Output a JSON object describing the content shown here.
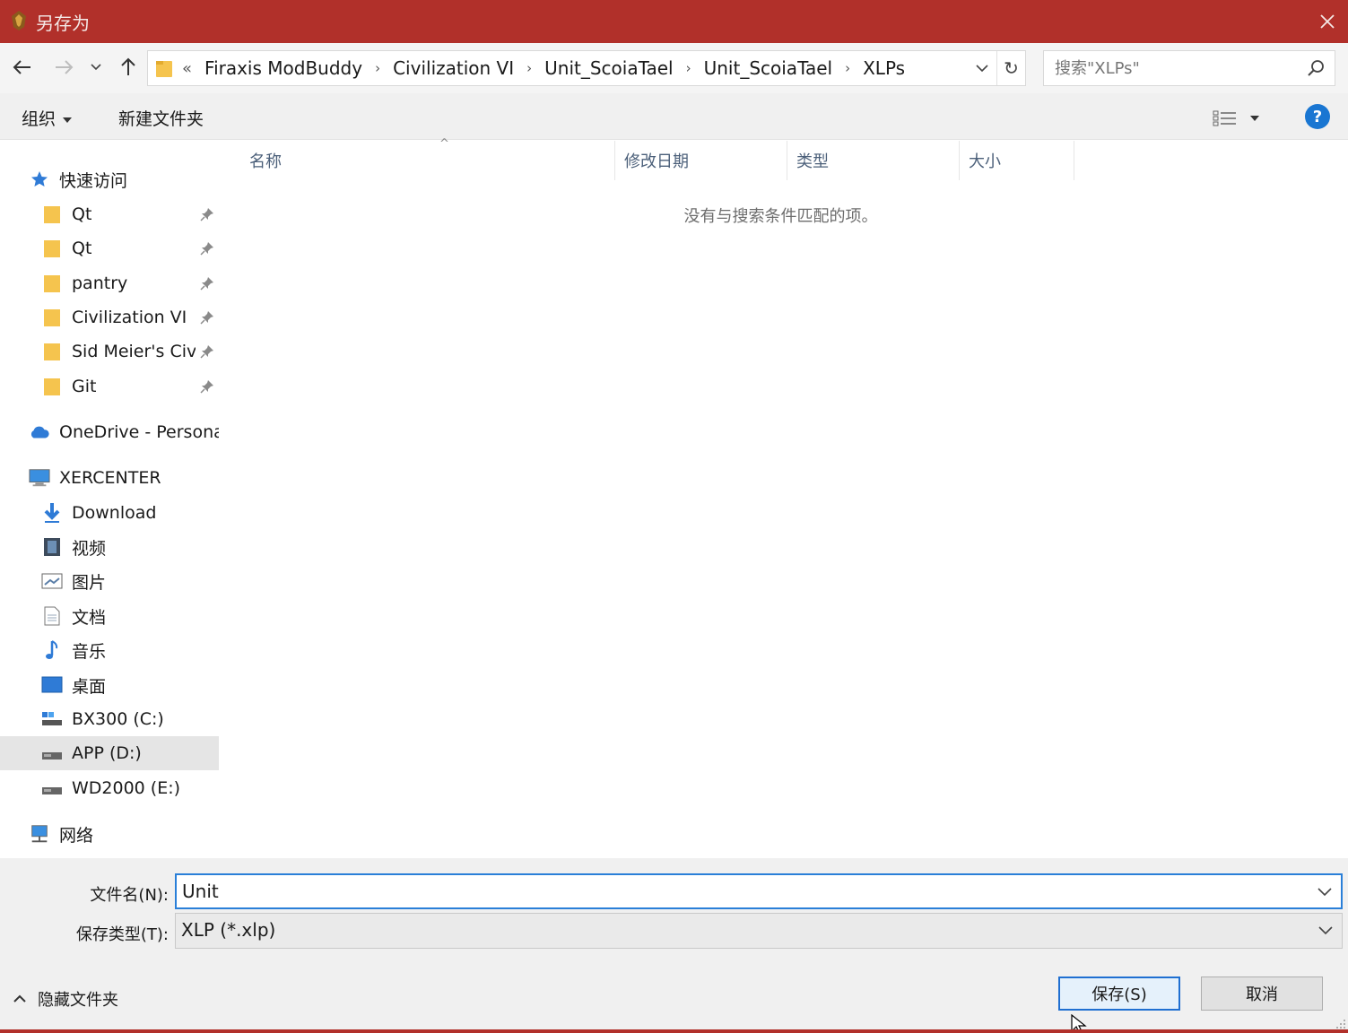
{
  "window": {
    "title": "另存为",
    "accent_color": "#b1302a"
  },
  "nav": {
    "breadcrumb_overflow": "«",
    "breadcrumbs": [
      "Firaxis ModBuddy",
      "Civilization VI",
      "Unit_ScoiaTael",
      "Unit_ScoiaTael",
      "XLPs"
    ],
    "search_placeholder": "搜索\"XLPs\""
  },
  "toolbar": {
    "organize": "组织",
    "new_folder": "新建文件夹"
  },
  "sidebar": {
    "quick_access": "快速访问",
    "quick_items": [
      "Qt",
      "Qt",
      "pantry",
      "Civilization VI",
      "Sid Meier's Civ",
      "Git"
    ],
    "onedrive": "OneDrive - Personal",
    "computer": "XERCENTER",
    "computer_items": [
      "Download",
      "视频",
      "图片",
      "文档",
      "音乐",
      "桌面",
      "BX300 (C:)",
      "APP (D:)",
      "WD2000 (E:)"
    ],
    "selected": "APP (D:)",
    "network": "网络"
  },
  "content": {
    "columns": [
      "名称",
      "修改日期",
      "类型",
      "大小"
    ],
    "empty_message": "没有与搜索条件匹配的项。"
  },
  "form": {
    "filename_label": "文件名(N):",
    "filename_value": "Unit",
    "filetype_label": "保存类型(T):",
    "filetype_value": "XLP (*.xlp)"
  },
  "footer": {
    "hide_folders": "隐藏文件夹",
    "save_button": "保存(S)",
    "cancel_button": "取消"
  }
}
